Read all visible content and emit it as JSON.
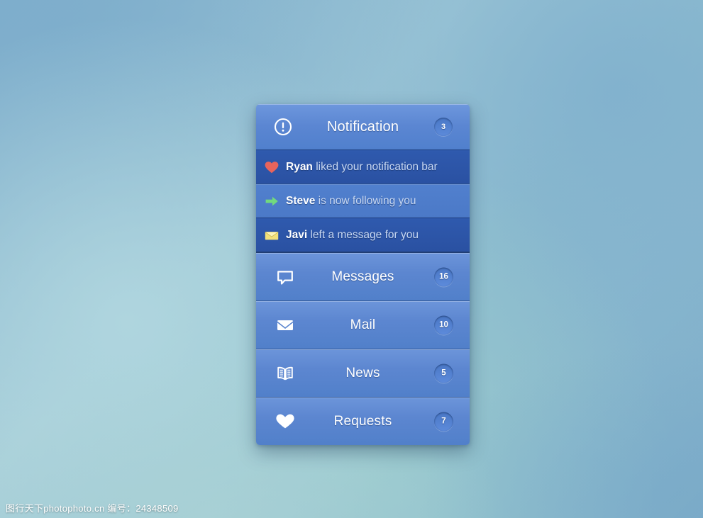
{
  "background": {
    "base_color": "#84b2cc",
    "accent_color": "#5b86d2"
  },
  "panel": {
    "header": {
      "icon": "exclamation-circle-icon",
      "title": "Notification",
      "badge": "3"
    },
    "notifications": [
      {
        "icon": "heart-icon",
        "icon_color": "#e8645c",
        "actor": "Ryan",
        "message": " liked your notification bar",
        "tone": "dark"
      },
      {
        "icon": "arrow-right-icon",
        "icon_color": "#72d97e",
        "actor": "Steve",
        "message": " is now following you",
        "tone": "light"
      },
      {
        "icon": "envelope-icon",
        "icon_color": "#f2e07a",
        "actor": "Javi",
        "message": " left a message for you",
        "tone": "dark"
      }
    ],
    "menu": [
      {
        "icon": "speech-bubble-icon",
        "label": "Messages",
        "badge": "16"
      },
      {
        "icon": "envelope-icon",
        "label": "Mail",
        "badge": "10"
      },
      {
        "icon": "open-book-icon",
        "label": "News",
        "badge": "5"
      },
      {
        "icon": "heart-icon",
        "label": "Requests",
        "badge": "7"
      }
    ]
  },
  "watermark": {
    "text": "图行天下photophoto.cn  编号：24348509"
  }
}
